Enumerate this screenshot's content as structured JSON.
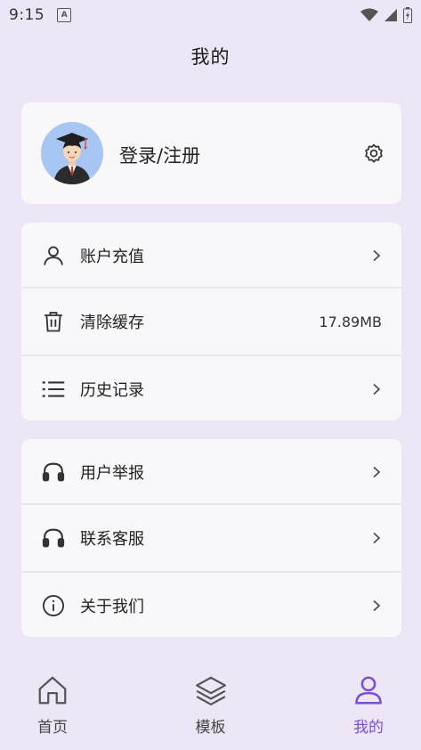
{
  "status_bar": {
    "time": "9:15",
    "notification_icon": "text-a-icon"
  },
  "header": {
    "title": "我的"
  },
  "profile": {
    "login_label": "登录/注册",
    "avatar_icon": "graduate-avatar",
    "settings_icon": "gear-icon"
  },
  "account_section": [
    {
      "label": "账户充值",
      "icon": "person-icon",
      "trailing": "chevron"
    },
    {
      "label": "清除缓存",
      "icon": "trash-icon",
      "value": "17.89MB"
    },
    {
      "label": "历史记录",
      "icon": "list-icon",
      "trailing": "chevron"
    }
  ],
  "support_section": [
    {
      "label": "用户举报",
      "icon": "headphones-icon",
      "trailing": "chevron"
    },
    {
      "label": "联系客服",
      "icon": "headphones-icon",
      "trailing": "chevron"
    },
    {
      "label": "关于我们",
      "icon": "info-icon",
      "trailing": "chevron"
    }
  ],
  "bottom_nav": [
    {
      "label": "首页",
      "icon": "home-icon",
      "active": false
    },
    {
      "label": "模板",
      "icon": "layers-icon",
      "active": false
    },
    {
      "label": "我的",
      "icon": "user-icon",
      "active": true
    }
  ],
  "colors": {
    "background": "#ece6f6",
    "card": "#f8f8fa",
    "accent": "#7a4fd8",
    "avatar_bg": "#a7c6f2"
  }
}
